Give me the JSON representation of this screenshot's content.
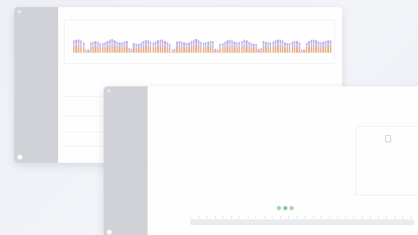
{
  "app": {
    "brand": "",
    "user_name": "",
    "user_role": ""
  },
  "back_window": {
    "breadcrumb": "",
    "topbar": [],
    "nav_top": [],
    "nav_sections": [],
    "chart_panel_label": "",
    "chart_corner_label": "",
    "filter_label": "",
    "table_headers": [],
    "table_rows": []
  },
  "front_window": {
    "breadcrumb": "",
    "topbar": [],
    "nav_top": [],
    "nav_sections": [],
    "timeseries_labels": [],
    "camera_labels": [],
    "empty_state_label": "",
    "empty_state_text": "",
    "bottom_controls": []
  },
  "colors": {
    "sidebar": "#cfd1d6",
    "accent": "#8fd0a1",
    "bar_stack": [
      "#e9b27a",
      "#f2a7a7",
      "#b9c9ea",
      "#c6a9e3"
    ]
  }
}
